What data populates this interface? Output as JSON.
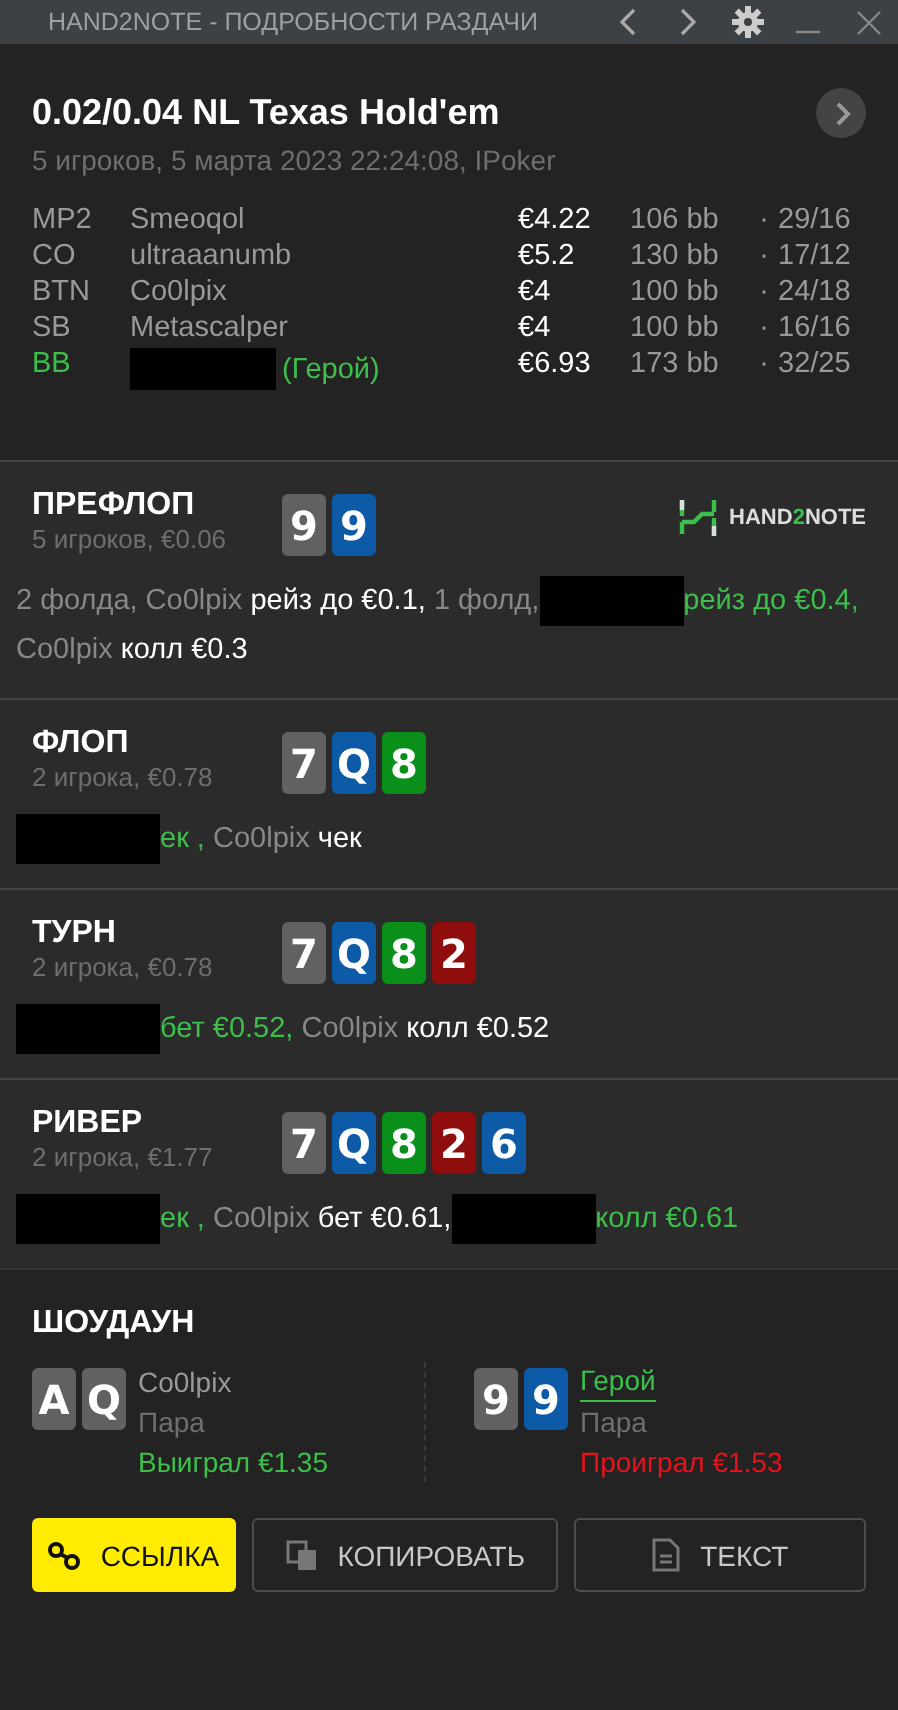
{
  "window": {
    "title": "HAND2NOTE - ПОДРОБНОСТИ РАЗДАЧИ"
  },
  "header": {
    "title": "0.02/0.04 NL Texas Hold'em",
    "subtitle": "5 игроков, 5 марта 2023 22:24:08, IPoker",
    "players": [
      {
        "position": "MP2",
        "name": "Smeoqol",
        "hero": false,
        "stack": "€4.22",
        "bb": "106 bb",
        "sep": "·",
        "stats": "29/16"
      },
      {
        "position": "CO",
        "name": "ultraaanumb",
        "hero": false,
        "stack": "€5.2",
        "bb": "130 bb",
        "sep": "·",
        "stats": "17/12"
      },
      {
        "position": "BTN",
        "name": "Co0lpix",
        "hero": false,
        "stack": "€4",
        "bb": "100 bb",
        "sep": "·",
        "stats": "24/18"
      },
      {
        "position": "SB",
        "name": "Metascalper",
        "hero": false,
        "stack": "€4",
        "bb": "100 bb",
        "sep": "·",
        "stats": "16/16"
      },
      {
        "position": "BB",
        "redacted": true,
        "hero_label": "(Герой)",
        "hero": true,
        "stack": "€6.93",
        "bb": "173 bb",
        "sep": "·",
        "stats": "32/25"
      }
    ]
  },
  "streets": [
    {
      "name": "ПРЕФЛОП",
      "info": "5 игроков, €0.06",
      "logo": [
        {
          "text": "HAND",
          "accent": false
        },
        {
          "text": "2",
          "accent": true
        },
        {
          "text": "NOTE",
          "accent": false
        }
      ],
      "cards": [
        {
          "rank": "9",
          "color": "#616161"
        },
        {
          "rank": "9",
          "color": "#0d5aa7"
        }
      ],
      "actions": [
        {
          "kind": "muted",
          "text": "2 фолда, Co0lpix"
        },
        {
          "kind": "white",
          "text": " рейз до €0.1,"
        },
        {
          "kind": "muted",
          "text": " 1 фолд,"
        },
        {
          "kind": "redacted"
        },
        {
          "kind": "hero",
          "text": "рейз до €0.4,"
        },
        {
          "kind": "muted",
          "text": " Co0lpix"
        },
        {
          "kind": "white",
          "text": " колл €0.3"
        }
      ]
    },
    {
      "name": "ФЛОП",
      "info": "2 игрока, €0.78",
      "cards": [
        {
          "rank": "7",
          "color": "#616161"
        },
        {
          "rank": "Q",
          "color": "#0d5aa7"
        },
        {
          "rank": "8",
          "color": "#0a8f1a"
        }
      ],
      "actions": [
        {
          "kind": "redacted"
        },
        {
          "kind": "hero",
          "text": "ек ,"
        },
        {
          "kind": "muted",
          "text": " Co0lpix"
        },
        {
          "kind": "white",
          "text": " чек"
        }
      ]
    },
    {
      "name": "ТУРН",
      "info": "2 игрока, €0.78",
      "cards": [
        {
          "rank": "7",
          "color": "#616161"
        },
        {
          "rank": "Q",
          "color": "#0d5aa7"
        },
        {
          "rank": "8",
          "color": "#0a8f1a"
        },
        {
          "rank": "2",
          "color": "#8f0d0d"
        }
      ],
      "actions": [
        {
          "kind": "redacted"
        },
        {
          "kind": "hero",
          "text": "бет €0.52,"
        },
        {
          "kind": "muted",
          "text": " Co0lpix"
        },
        {
          "kind": "white",
          "text": " колл €0.52"
        }
      ]
    },
    {
      "name": "РИВЕР",
      "info": "2 игрока, €1.77",
      "cards": [
        {
          "rank": "7",
          "color": "#616161"
        },
        {
          "rank": "Q",
          "color": "#0d5aa7"
        },
        {
          "rank": "8",
          "color": "#0a8f1a"
        },
        {
          "rank": "2",
          "color": "#8f0d0d"
        },
        {
          "rank": "6",
          "color": "#0d5aa7"
        }
      ],
      "actions": [
        {
          "kind": "redacted"
        },
        {
          "kind": "hero",
          "text": "ек ,"
        },
        {
          "kind": "muted",
          "text": " Co0lpix"
        },
        {
          "kind": "white",
          "text": " бет €0.61,"
        },
        {
          "kind": "redacted"
        },
        {
          "kind": "hero",
          "text": "колл €0.61"
        }
      ]
    }
  ],
  "showdown": {
    "title": "ШОУДАУН",
    "players": [
      {
        "name": "Co0lpix",
        "hero": false,
        "hand": "Пара",
        "result": "Выиграл €1.35",
        "kind": "won",
        "cards": [
          {
            "rank": "A",
            "color": "#616161"
          },
          {
            "rank": "Q",
            "color": "#616161"
          }
        ]
      },
      {
        "name": "Герой",
        "hero": true,
        "hand": "Пара",
        "result": "Проиграл €1.53",
        "kind": "lost",
        "cards": [
          {
            "rank": "9",
            "color": "#616161"
          },
          {
            "rank": "9",
            "color": "#0d5aa7"
          }
        ]
      }
    ]
  },
  "buttons": [
    {
      "label": "ССЫЛКА",
      "kind": "primary"
    },
    {
      "label": "КОПИРОВАТЬ",
      "kind": "outline"
    },
    {
      "label": "ТЕКСТ",
      "kind": "outline"
    }
  ]
}
